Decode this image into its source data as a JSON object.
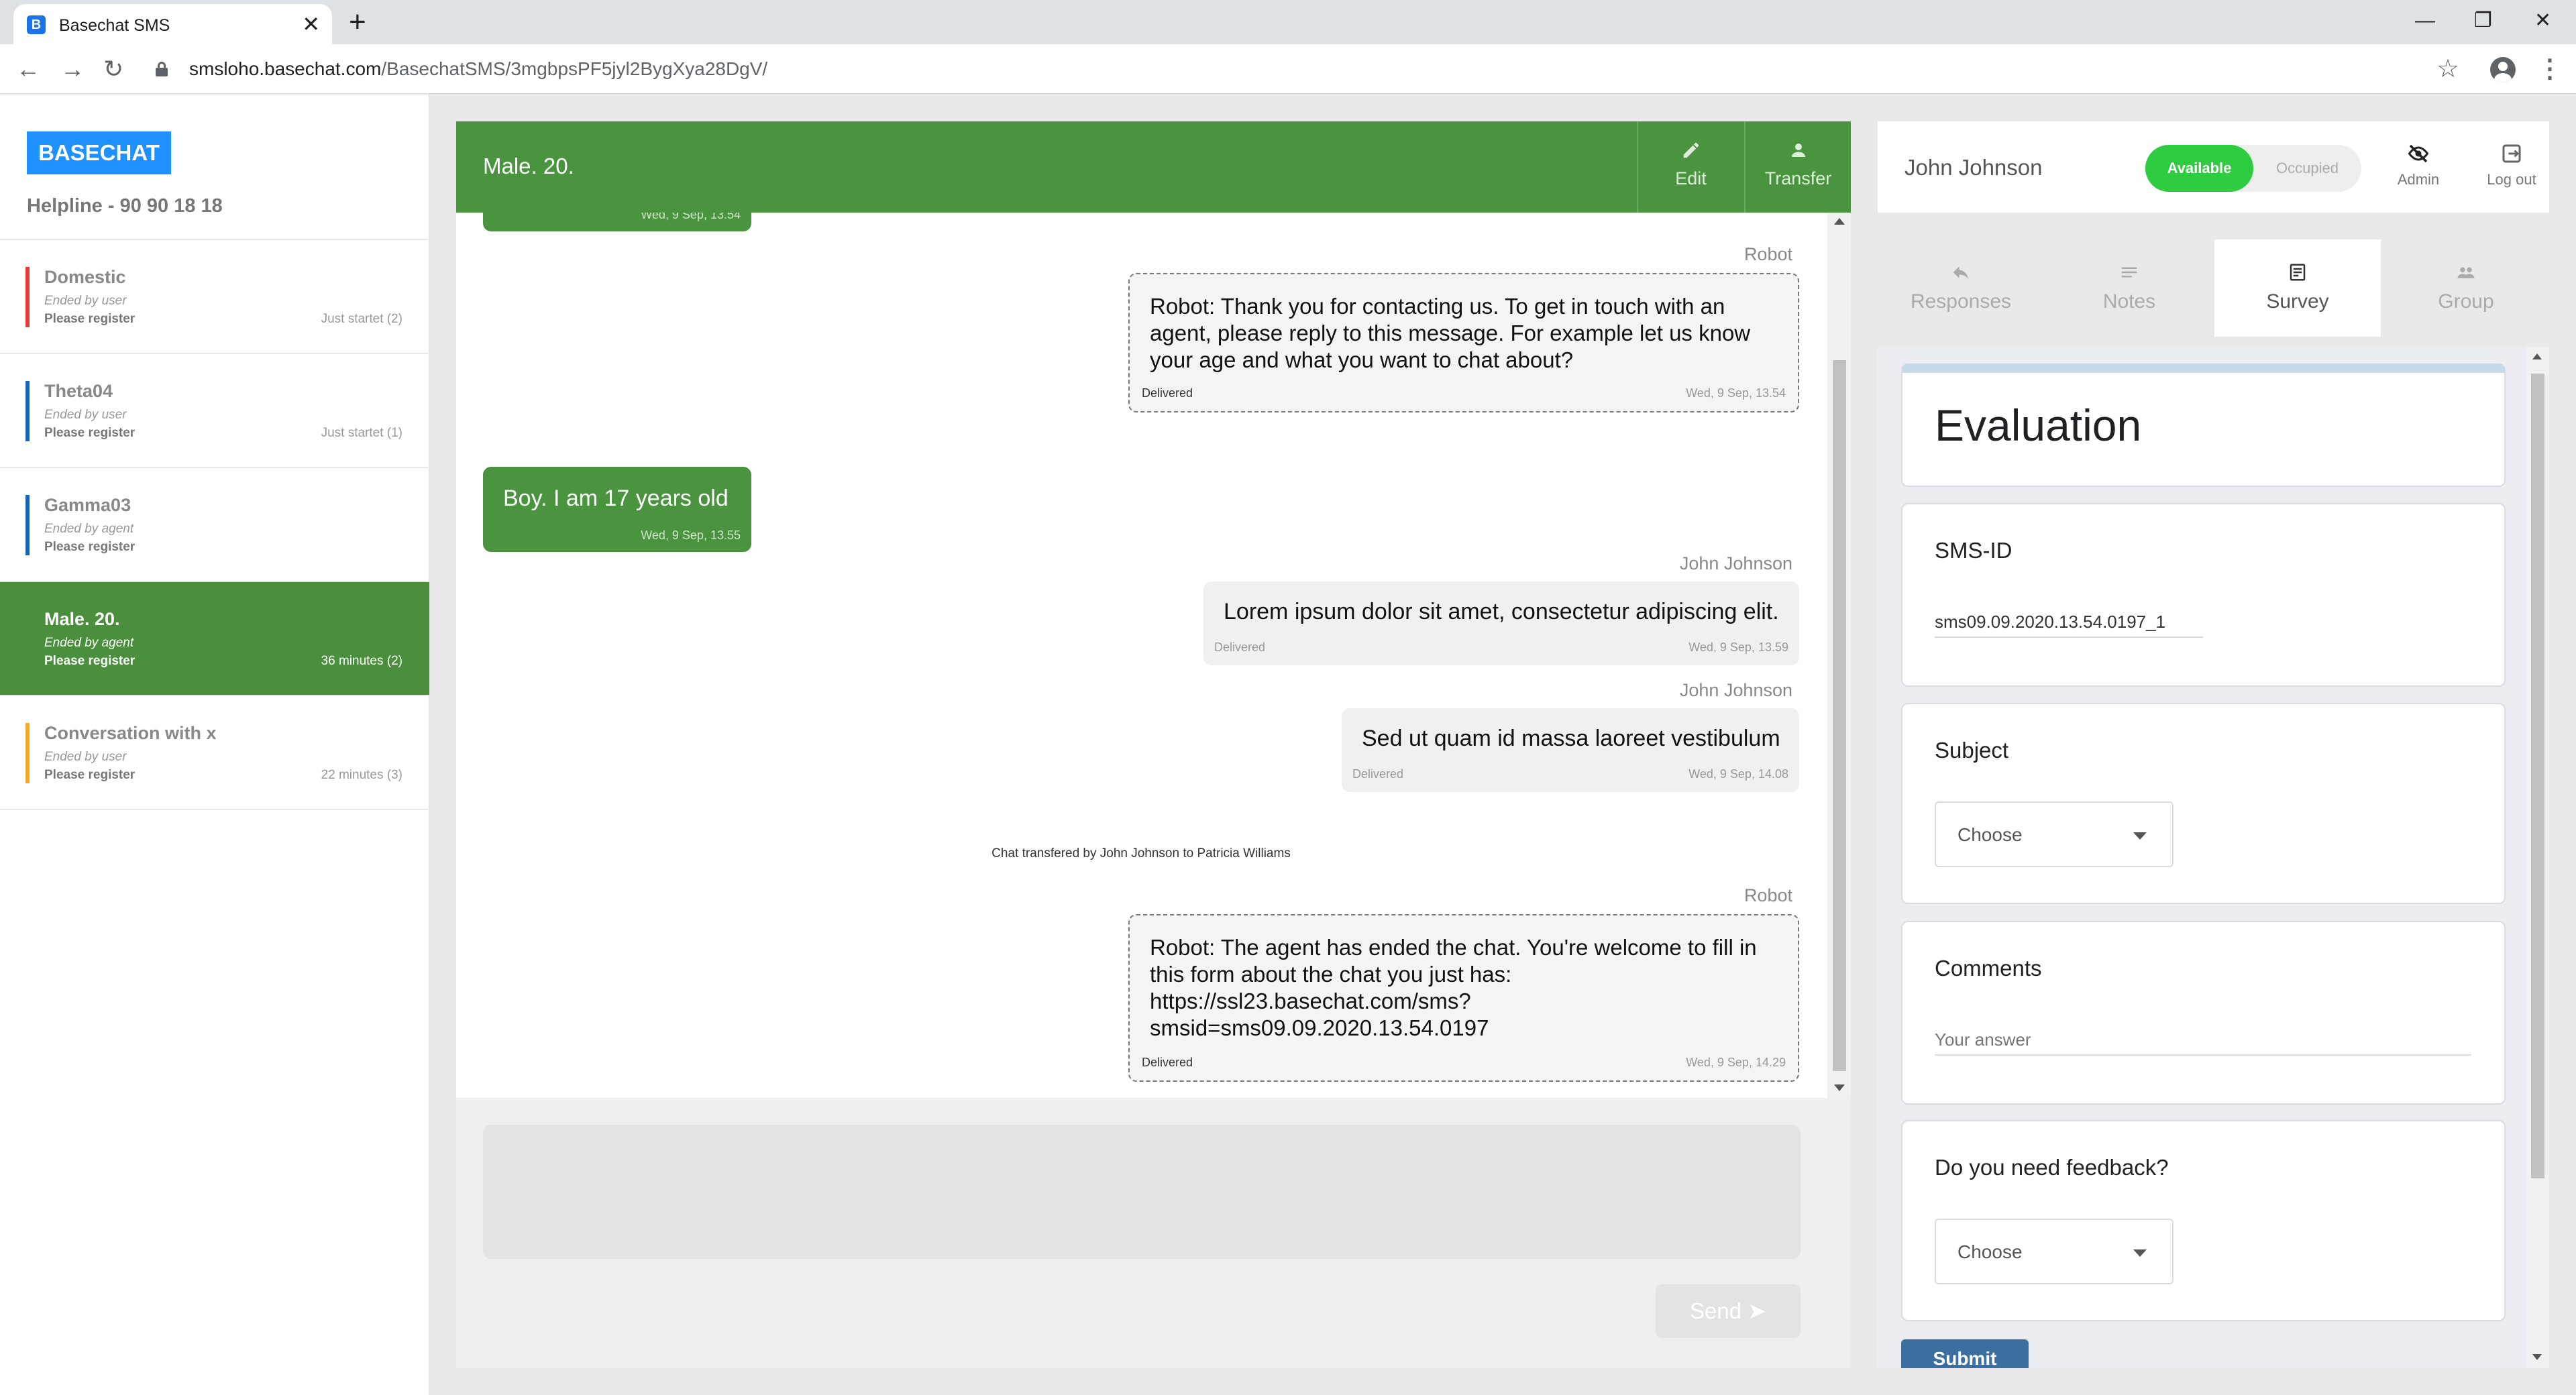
{
  "browser": {
    "tab_title": "Basechat SMS",
    "favicon_letter": "B",
    "tab_close": "✕",
    "new_tab": "+",
    "url_host": "smsloho.basechat.com",
    "url_path": "/BasechatSMS/3mgbpsPF5jyl2BygXya28DgV/",
    "minimize": "—",
    "maximize": "❐",
    "close": "✕",
    "back": "←",
    "forward": "→",
    "reload": "↻",
    "star": "☆",
    "menu": "⋮"
  },
  "sidebar": {
    "brand": "BASECHAT",
    "helpline": "Helpline - 90 90 18 18",
    "conversations": [
      {
        "name": "Domestic",
        "status": "Ended by user",
        "register": "Please register",
        "time": "Just startet (2)",
        "color": "#e53935",
        "active": false
      },
      {
        "name": "Theta04",
        "status": "Ended by user",
        "register": "Please register",
        "time": "Just startet (1)",
        "color": "#1565c0",
        "active": false
      },
      {
        "name": "Gamma03",
        "status": "Ended by agent",
        "register": "Please register",
        "time": "",
        "color": "#1565c0",
        "active": false
      },
      {
        "name": "Male. 20.",
        "status": "Ended by agent",
        "register": "Please register",
        "time": "36 minutes (2)",
        "color": "#4a8f3c",
        "active": true
      },
      {
        "name": "Conversation with x",
        "status": "Ended by user",
        "register": "Please register",
        "time": "22 minutes (3)",
        "color": "#f9a825",
        "active": false
      }
    ]
  },
  "chat": {
    "title": "Male. 20.",
    "edit_label": "Edit",
    "transfer_label": "Transfer",
    "messages": {
      "m0_date": "Wed, 9 Sep, 13.54",
      "m1_sender": "Robot",
      "m1_text": "Robot: Thank you for contacting us. To get in touch with an agent, please reply to this message. For example let us know your age and what you want to chat about?",
      "m1_status": "Delivered",
      "m1_date": "Wed, 9 Sep, 13.54",
      "m2_text": "Boy. I am 17 years old",
      "m2_date": "Wed, 9 Sep, 13.55",
      "m3_sender": "John Johnson",
      "m3_text": "Lorem ipsum dolor sit amet, consectetur adipiscing elit.",
      "m3_status": "Delivered",
      "m3_date": "Wed, 9 Sep, 13.59",
      "m4_sender": "John Johnson",
      "m4_text": "Sed ut quam id massa laoreet vestibulum",
      "m4_status": "Delivered",
      "m4_date": "Wed, 9 Sep, 14.08",
      "system": "Chat transfered by John Johnson to Patricia Williams",
      "m5_sender": "Robot",
      "m5_text_1": "Robot: The agent has ended the chat. You're welcome to fill in this form about the chat you just has:",
      "m5_text_2": "https://ssl23.basechat.com/sms?",
      "m5_text_3": "smsid=sms09.09.2020.13.54.0197",
      "m5_status": "Delivered",
      "m5_date": "Wed, 9 Sep, 14.29"
    },
    "compose_value": "",
    "send_label": "Send",
    "send_icon": "➤"
  },
  "agent": {
    "name": "John Johnson",
    "available_label": "Available",
    "occupied_label": "Occupied",
    "status": "Available",
    "admin_label": "Admin",
    "logout_label": "Log out"
  },
  "panel_tabs": [
    {
      "label": "Responses",
      "icon": "reply-icon",
      "active": false
    },
    {
      "label": "Notes",
      "icon": "notes-icon",
      "active": false
    },
    {
      "label": "Survey",
      "icon": "survey-icon",
      "active": true
    },
    {
      "label": "Group",
      "icon": "group-icon",
      "active": false
    }
  ],
  "survey": {
    "title": "Evaluation",
    "smsid_label": "SMS-ID",
    "smsid_value": "sms09.09.2020.13.54.0197_1",
    "subject_label": "Subject",
    "subject_value": "Choose",
    "comments_label": "Comments",
    "comments_placeholder": "Your answer",
    "feedback_label": "Do you need feedback?",
    "feedback_value": "Choose",
    "submit_label": "Submit"
  },
  "colors": {
    "brand": "#1e90ff",
    "chat_header": "#4a9440",
    "available": "#2ecc40",
    "submit": "#3a6fa0"
  }
}
